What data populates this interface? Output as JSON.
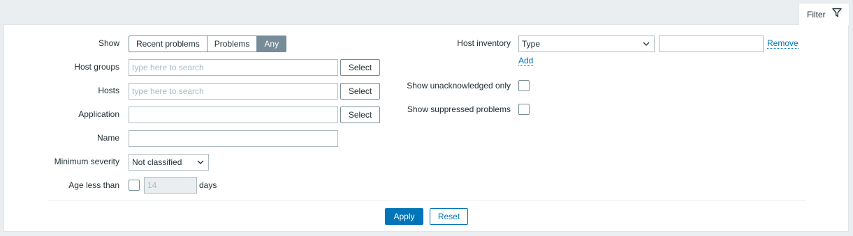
{
  "tab": {
    "label": "Filter",
    "icon": "funnel-icon"
  },
  "left": {
    "show": {
      "label": "Show",
      "options": [
        "Recent problems",
        "Problems",
        "Any"
      ],
      "selected": "Any"
    },
    "host_groups": {
      "label": "Host groups",
      "placeholder": "type here to search",
      "value": "",
      "button": "Select"
    },
    "hosts": {
      "label": "Hosts",
      "placeholder": "type here to search",
      "value": "",
      "button": "Select"
    },
    "application": {
      "label": "Application",
      "value": "",
      "button": "Select"
    },
    "name": {
      "label": "Name",
      "value": ""
    },
    "minimum_severity": {
      "label": "Minimum severity",
      "value": "Not classified"
    },
    "age_less_than": {
      "label": "Age less than",
      "checked": false,
      "value": "14",
      "unit": "days"
    }
  },
  "right": {
    "host_inventory": {
      "label": "Host inventory",
      "field": "Type",
      "value": "",
      "remove": "Remove",
      "add": "Add"
    },
    "show_unacknowledged": {
      "label": "Show unacknowledged only",
      "checked": false
    },
    "show_suppressed": {
      "label": "Show suppressed problems",
      "checked": false
    }
  },
  "actions": {
    "apply": "Apply",
    "reset": "Reset"
  },
  "colors": {
    "page_bg": "#ebeef0",
    "panel_bg": "#ffffff",
    "primary": "#0275b8",
    "segment_active": "#768d99",
    "border": "#acbbc2"
  }
}
